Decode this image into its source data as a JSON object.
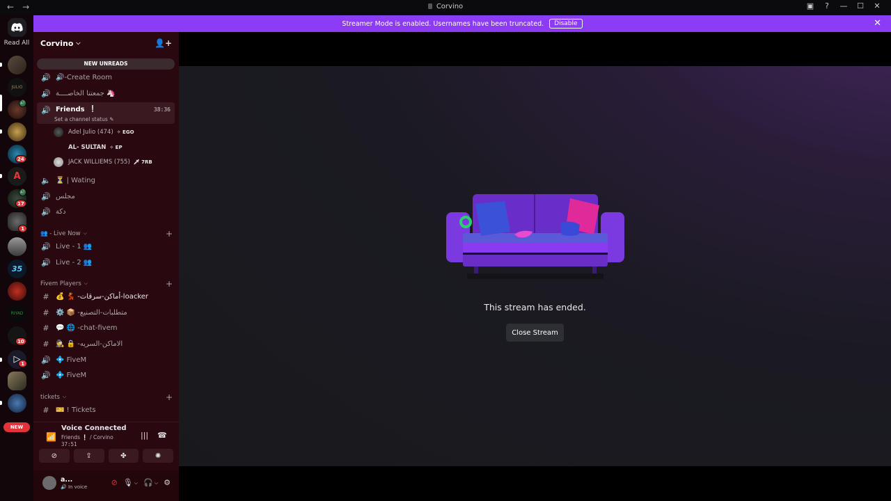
{
  "titlebar": {
    "title": "Corvino",
    "back": "←",
    "forward": "→"
  },
  "banner": {
    "message": "Streamer Mode is enabled. Usernames have been truncated.",
    "disable_label": "Disable",
    "close": "✕"
  },
  "rail": {
    "read_all": "Read All",
    "badges": {
      "b1": "24",
      "b2": "17",
      "b3": "1",
      "b4": "10",
      "b5": "1"
    },
    "new_label": "NEW"
  },
  "server": {
    "name": "Corvino",
    "new_unreads": "NEW UNREADS",
    "channels": {
      "create_room": "🔊-Create Room",
      "arabic1": "جمعتنا الخاصــــة 🦄",
      "friends": "Friends",
      "friends_timer": "38:36",
      "friends_status": "Set a channel status",
      "wating": "⏳ | Wating",
      "majlis": "مجلس",
      "dakka": "دكة",
      "live1": "Live - 1 👥",
      "live2": "Live - 2 👥",
      "text1": "💰 💃 -أماكن-سرقات-loacker",
      "text2": "⚙️ 📦 -متطلبات-التصنيع",
      "text3": "💬 🌐 -chat-fivem",
      "text4": "🕵️ 🔒 -الاماكن-السريه",
      "fivem1": "💠 FiveM",
      "fivem2": "💠 FiveM",
      "tickets": "🎫 ! Tickets"
    },
    "voice_users": {
      "u1_name": "Adel Julio (474)",
      "u1_tag": "EGO",
      "u2_name": "AL- SULTAN",
      "u2_tag": "EP",
      "u3_name": "JACK WILLIEMS (755)",
      "u3_tag": "7RB"
    },
    "categories": {
      "live_now": "👥 - Live Now",
      "fivem_players": "Fivem Players",
      "tickets": "tickets"
    }
  },
  "voice_panel": {
    "title": "Voice Connected",
    "channel": "Friends  ❕ / Corvino",
    "time": "37:51"
  },
  "user": {
    "name": "a...",
    "status": "In voice"
  },
  "stream": {
    "ended_text": "This stream has ended.",
    "close_label": "Close Stream"
  }
}
